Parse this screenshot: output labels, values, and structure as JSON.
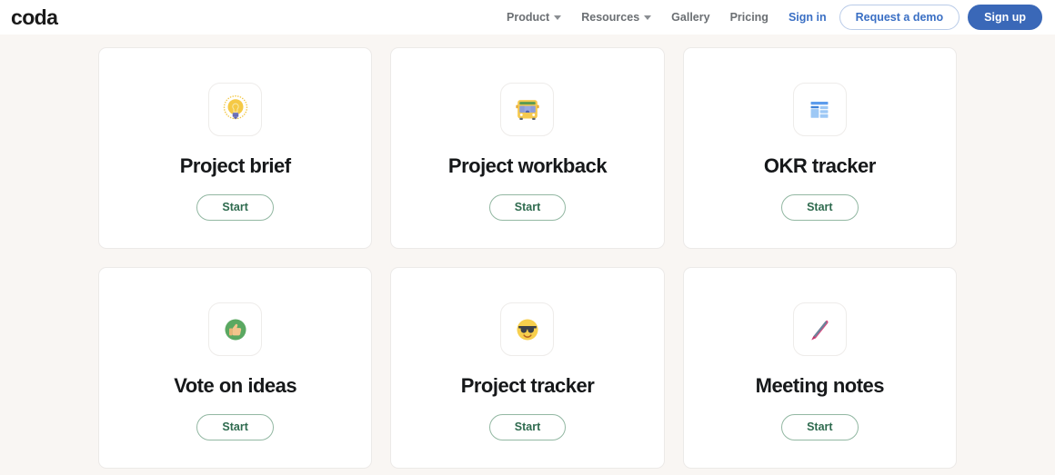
{
  "header": {
    "logo": "coda",
    "nav": [
      {
        "label": "Product",
        "name": "nav-product",
        "caret": true
      },
      {
        "label": "Resources",
        "name": "nav-resources",
        "caret": true
      },
      {
        "label": "Gallery",
        "name": "nav-gallery",
        "caret": false
      },
      {
        "label": "Pricing",
        "name": "nav-pricing",
        "caret": false
      }
    ],
    "sign_in_label": "Sign in",
    "demo_label": "Request a demo",
    "sign_up_label": "Sign up",
    "colors": {
      "brand_blue": "#3a68b8",
      "link_blue": "#3a6fc4",
      "nav_gray": "#6b6f73",
      "page_bg": "#f9f6f3",
      "start_green": "#2f6b4f"
    }
  },
  "cards": [
    {
      "title": "Project brief",
      "start_label": "Start",
      "icon_name": "light-bulb-icon",
      "icon_kind": "bulb"
    },
    {
      "title": "Project workback",
      "start_label": "Start",
      "icon_name": "school-bus-icon",
      "icon_kind": "bus"
    },
    {
      "title": "OKR tracker",
      "start_label": "Start",
      "icon_name": "layout-grid-icon",
      "icon_kind": "layout"
    },
    {
      "title": "Vote on ideas",
      "start_label": "Start",
      "icon_name": "thumbs-up-icon",
      "icon_kind": "thumbsup"
    },
    {
      "title": "Project tracker",
      "start_label": "Start",
      "icon_name": "smiling-face-with-sunglasses-icon",
      "icon_kind": "sunglasses"
    },
    {
      "title": "Meeting notes",
      "start_label": "Start",
      "icon_name": "pen-icon",
      "icon_kind": "pen"
    }
  ]
}
